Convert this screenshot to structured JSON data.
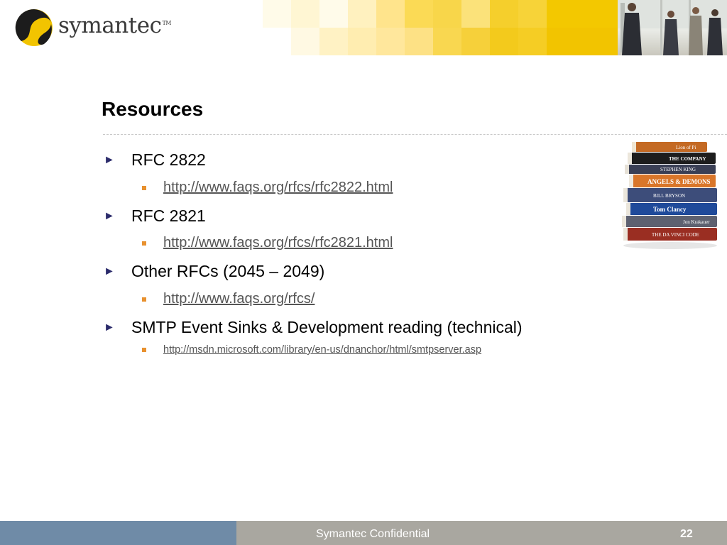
{
  "header": {
    "logo_text": "symantec",
    "logo_tm": "TM"
  },
  "slide": {
    "title": "Resources",
    "items": [
      {
        "label": "RFC 2822",
        "link": "http://www.faqs.org/rfcs/rfc2822.html"
      },
      {
        "label": "RFC 2821",
        "link": "http://www.faqs.org/rfcs/rfc2821.html"
      },
      {
        "label": "Other RFCs (2045 – 2049)",
        "link": "http://www.faqs.org/rfcs/"
      },
      {
        "label": "SMTP Event Sinks & Development reading (technical)",
        "link": "http://msdn.microsoft.com/library/en-us/dnanchor/html/smtpserver.asp"
      }
    ],
    "books": {
      "spines": [
        "Lion of Pi",
        "THE COMPANY",
        "STEPHEN KING",
        "ANGELS & DEMONS",
        "BILL BRYSON",
        "Tom Clancy",
        "Jon Krakauer",
        "THE DA VINCI CODE"
      ]
    }
  },
  "footer": {
    "confidential": "Symantec Confidential",
    "page_number": "22"
  },
  "colors": {
    "accent_orange": "#e8912f",
    "logo_yellow": "#f2c400",
    "footer_blue": "#6f8ba7",
    "footer_gray": "#a9a7a0",
    "bullet_navy": "#2b2b6b"
  }
}
